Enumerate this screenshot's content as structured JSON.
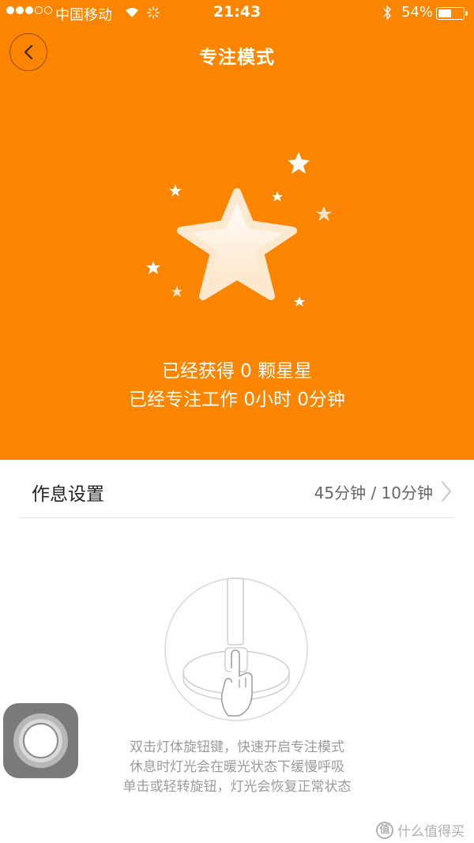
{
  "status_bar": {
    "carrier": "中国移动",
    "time": "21:43",
    "battery_percent_text": "54%",
    "battery_level": 0.54
  },
  "header": {
    "title": "专注模式",
    "back_icon": "chevron-left-icon"
  },
  "colors": {
    "accent": "#fc8500",
    "text_light": "#ffffff",
    "muted": "#9b9b9b"
  },
  "focus_stats": {
    "stars_text": "已经获得 0 颗星星",
    "time_text": "已经专注工作 0小时 0分钟"
  },
  "rest_setting": {
    "label": "作息设置",
    "value": "45分钟 / 10分钟"
  },
  "instructions": [
    "双击灯体旋钮键，快速开启专注模式",
    "休息时灯光会在暖光状态下缓慢呼吸",
    "单击或轻转旋钮，灯光会恢复正常状态"
  ],
  "watermark": {
    "logo_text": "值",
    "text": "什么值得买"
  }
}
